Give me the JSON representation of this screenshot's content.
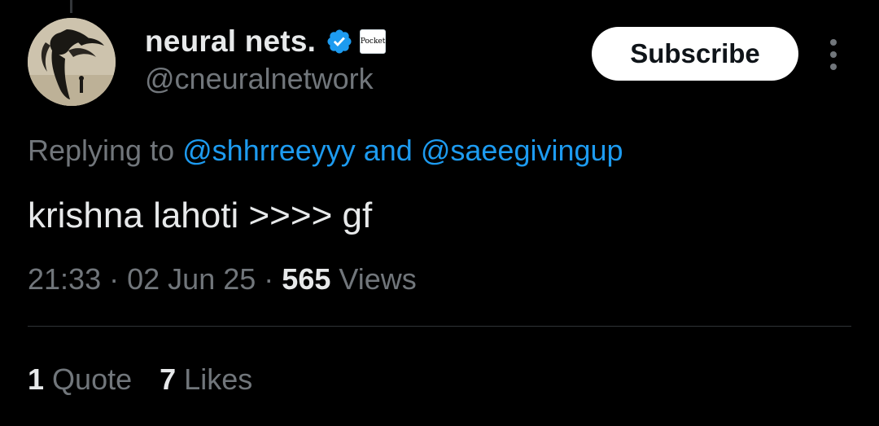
{
  "author": {
    "display_name": "neural nets.",
    "handle": "@cneuralnetwork",
    "affiliate_badge_text": "Pocket",
    "verified_icon": "verified-badge-icon"
  },
  "actions": {
    "subscribe_label": "Subscribe",
    "more_icon": "more-vertical-icon"
  },
  "reply_context": {
    "prefix": "Replying to",
    "mentions": [
      "@shhrreeyyy",
      "@saeegivingup"
    ],
    "joiner": "and"
  },
  "tweet": {
    "text": "krishna lahoti >>>> gf",
    "time": "21:33",
    "date": "02 Jun 25",
    "views_count": "565",
    "views_label": "Views",
    "separator": "·"
  },
  "stats": {
    "quotes_count": "1",
    "quotes_label": "Quote",
    "likes_count": "7",
    "likes_label": "Likes"
  },
  "colors": {
    "background": "#000000",
    "primary_text": "#e7e9ea",
    "secondary_text": "#71767b",
    "accent": "#1d9bf0",
    "divider": "#2f3336"
  }
}
